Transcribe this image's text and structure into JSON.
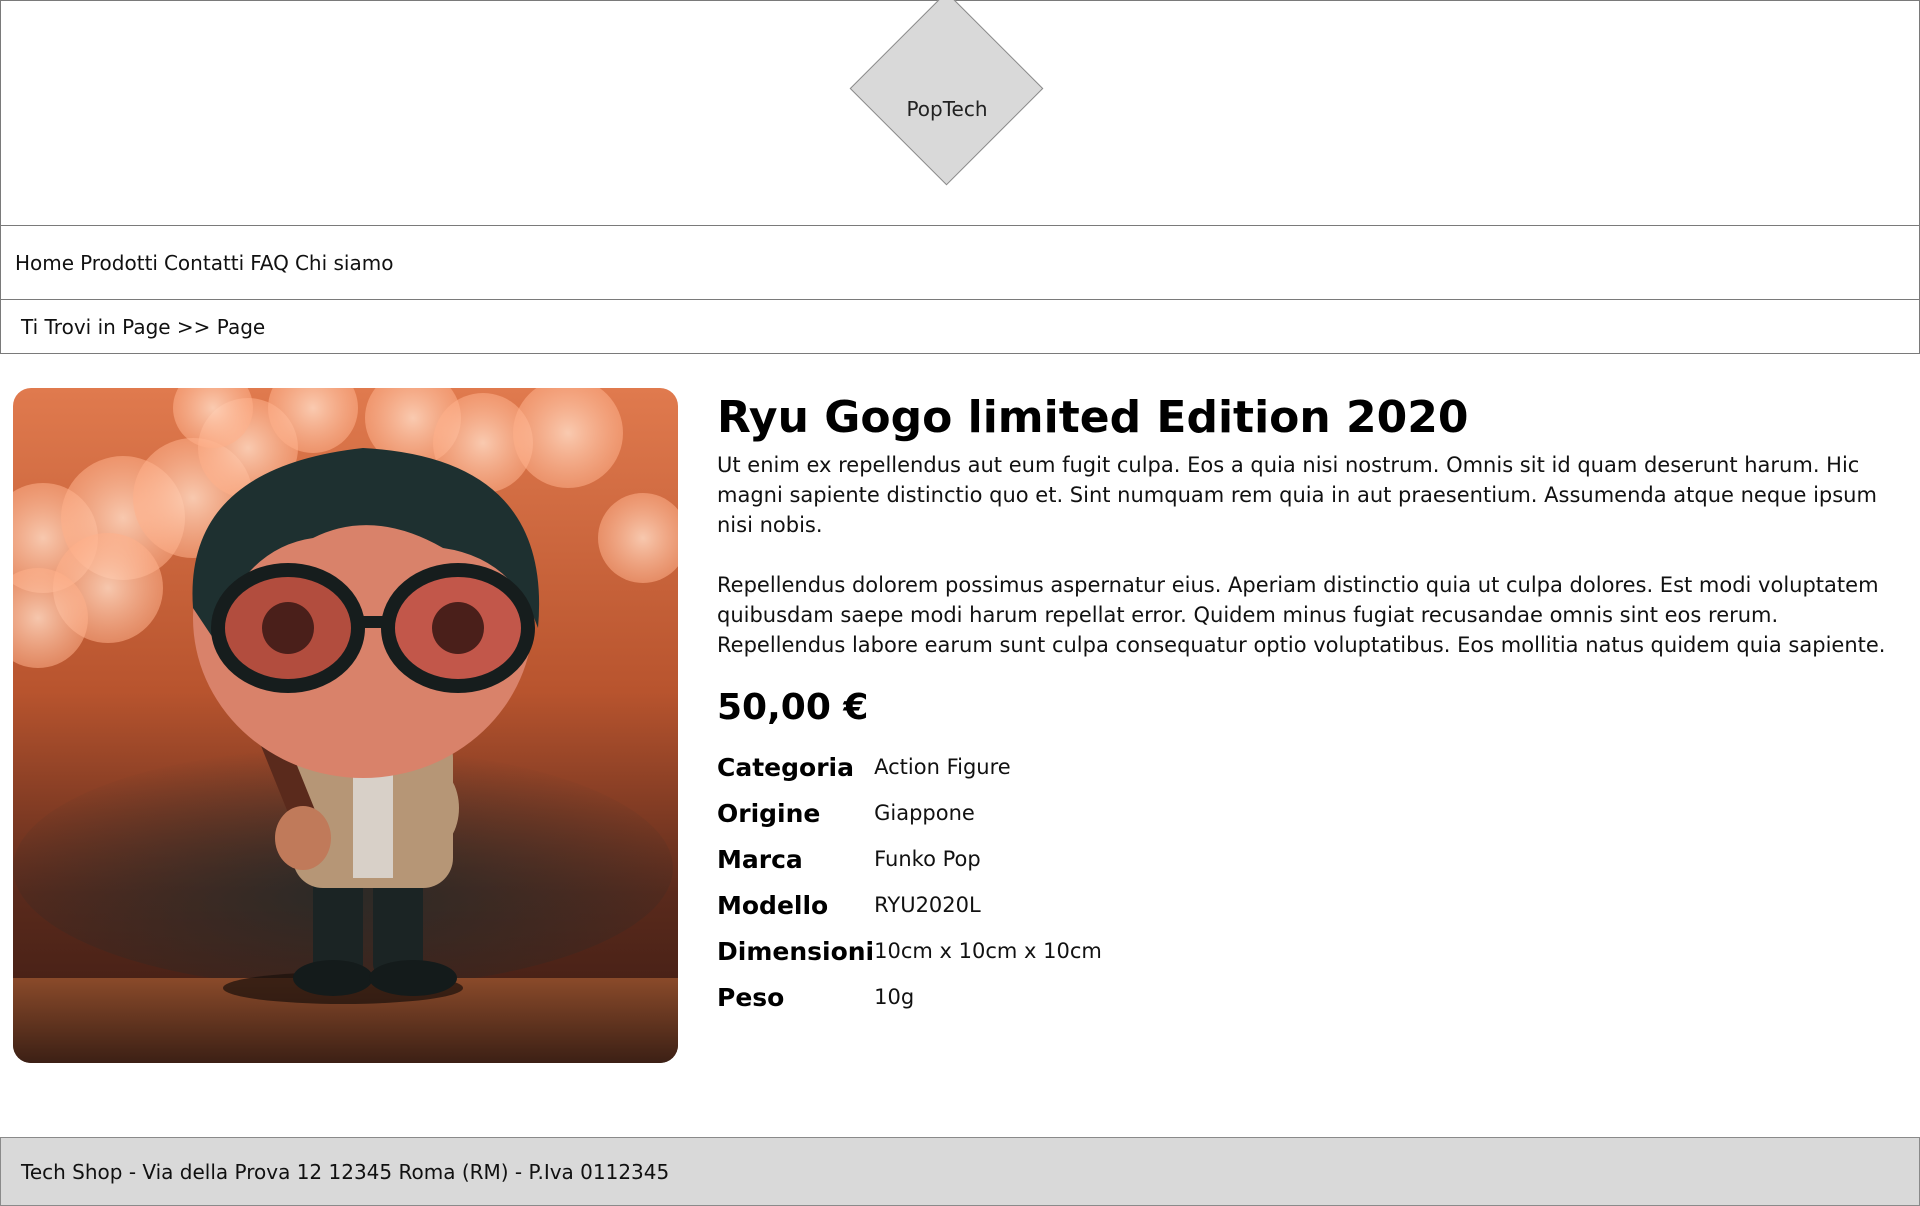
{
  "header": {
    "logo_text": "PopTech"
  },
  "nav": {
    "items": [
      {
        "label": "Home"
      },
      {
        "label": "Prodotti"
      },
      {
        "label": "Contatti"
      },
      {
        "label": "FAQ"
      },
      {
        "label": "Chi siamo"
      }
    ]
  },
  "breadcrumb": {
    "text": "Ti Trovi in Page >> Page"
  },
  "product": {
    "title": "Ryu Gogo limited Edition 2020",
    "description": [
      "Ut enim ex repellendus aut eum fugit culpa. Eos a quia nisi nostrum. Omnis sit id quam deserunt harum. Hic magni sapiente distinctio quo et. Sint numquam rem quia in aut praesentium. Assumenda atque neque ipsum nisi nobis.",
      "Repellendus dolorem possimus aspernatur eius. Aperiam distinctio quia ut culpa dolores. Est modi voluptatem quibusdam saepe modi harum repellat error. Quidem minus fugiat recusandae omnis sint eos rerum. Repellendus labore earum sunt culpa consequatur optio voluptatibus. Eos mollitia natus quidem quia sapiente."
    ],
    "price": "50,00 €",
    "specs": [
      {
        "label": "Categoria",
        "value": "Action Figure"
      },
      {
        "label": "Origine",
        "value": "Giappone"
      },
      {
        "label": "Marca",
        "value": "Funko Pop"
      },
      {
        "label": "Modello",
        "value": "RYU2020L"
      },
      {
        "label": "Dimensioni",
        "value": "10cm x 10cm x 10cm"
      },
      {
        "label": "Peso",
        "value": "10g"
      }
    ]
  },
  "footer": {
    "text": "Tech Shop - Via della Prova 12 12345 Roma (RM) - P.Iva 0112345"
  },
  "colors": {
    "logo_fill": "#d9d9d9",
    "footer_bg": "#d9d9d9",
    "border": "#7a7a7a",
    "photo_background": "#c8653a"
  }
}
